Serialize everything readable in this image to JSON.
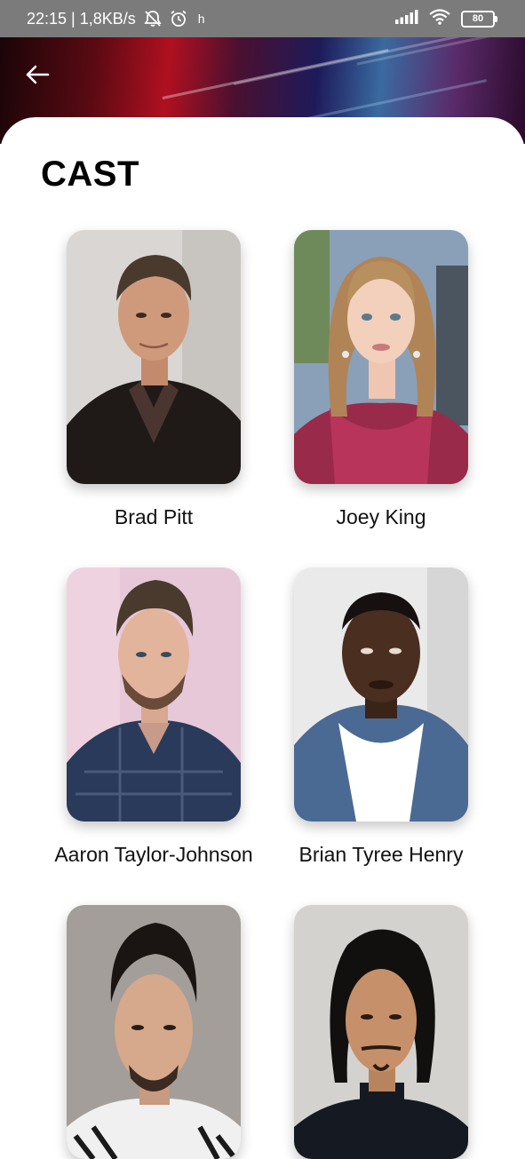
{
  "status_bar": {
    "time_speed": "22:15 | 1,8KB/s",
    "extra": "h",
    "battery": "80",
    "icons": [
      "mute-icon",
      "alarm-icon",
      "signal-icon",
      "wifi-icon",
      "battery-icon"
    ]
  },
  "header": {
    "back_icon": "arrow-left-icon"
  },
  "page": {
    "title": "CAST"
  },
  "cast": [
    {
      "name": "Brad Pitt"
    },
    {
      "name": "Joey King"
    },
    {
      "name": "Aaron Taylor-Johnson"
    },
    {
      "name": "Brian Tyree Henry"
    },
    {
      "name": ""
    },
    {
      "name": ""
    }
  ]
}
